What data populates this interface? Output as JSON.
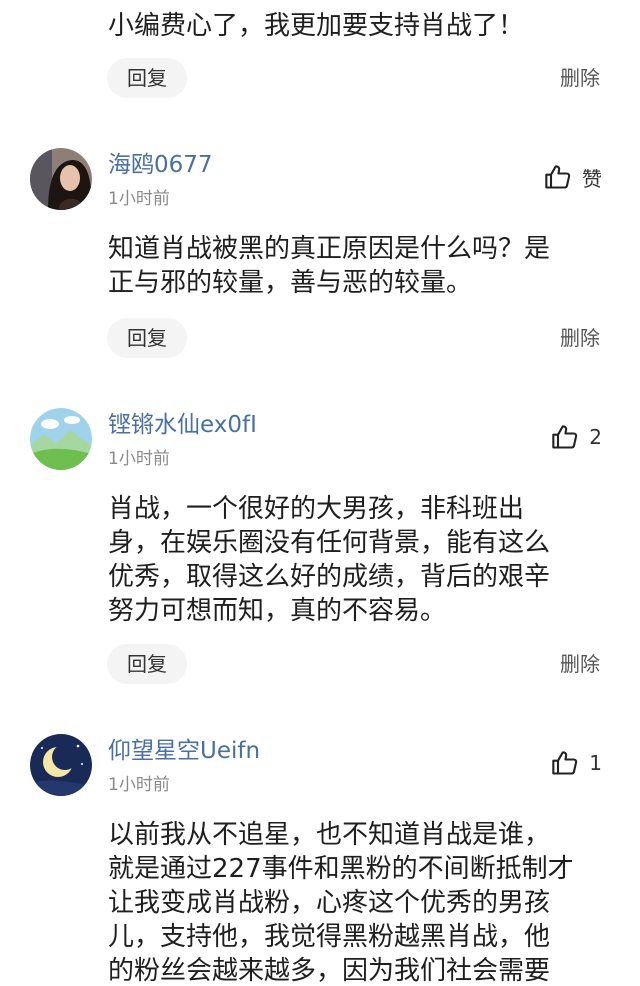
{
  "top_partial": {
    "text": "小编费心了，我更加要支持肖战了！",
    "reply_label": "回复",
    "delete_label": "删除"
  },
  "comments": [
    {
      "username": "海鸥0677",
      "time": "1小时前",
      "like_label": "赞",
      "lines": [
        "知道肖战被黑的真正原因是什么吗？是",
        "正与邪的较量，善与恶的较量。"
      ],
      "reply_label": "回复",
      "delete_label": "删除"
    },
    {
      "username": "铿锵水仙ex0fI",
      "time": "1小时前",
      "like_count": "2",
      "lines": [
        "肖战，一个很好的大男孩，非科班出",
        "身，在娱乐圈没有任何背景，能有这么",
        "优秀，取得这么好的成绩，背后的艰辛",
        "努力可想而知，真的不容易。"
      ],
      "reply_label": "回复",
      "delete_label": "删除"
    },
    {
      "username": "仰望星空Ueifn",
      "time": "1小时前",
      "like_count": "1",
      "lines": [
        "以前我从不追星，也不知道肖战是谁，",
        "就是通过227事件和黑粉的不间断抵制才",
        "让我变成肖战粉，心疼这个优秀的男孩",
        "儿，支持他，我觉得黑粉越黑肖战，他",
        "的粉丝会越来越多，因为我们社会需要"
      ]
    }
  ],
  "icons": {
    "like": "thumbs-up-icon",
    "avatar1": "woman-portrait-avatar",
    "avatar2": "landscape-avatar",
    "avatar3": "crescent-moon-avatar"
  },
  "colors": {
    "username": "#4a6fa5",
    "reply_bg": "#f4f4f4",
    "timestamp": "#8a8a8a"
  }
}
